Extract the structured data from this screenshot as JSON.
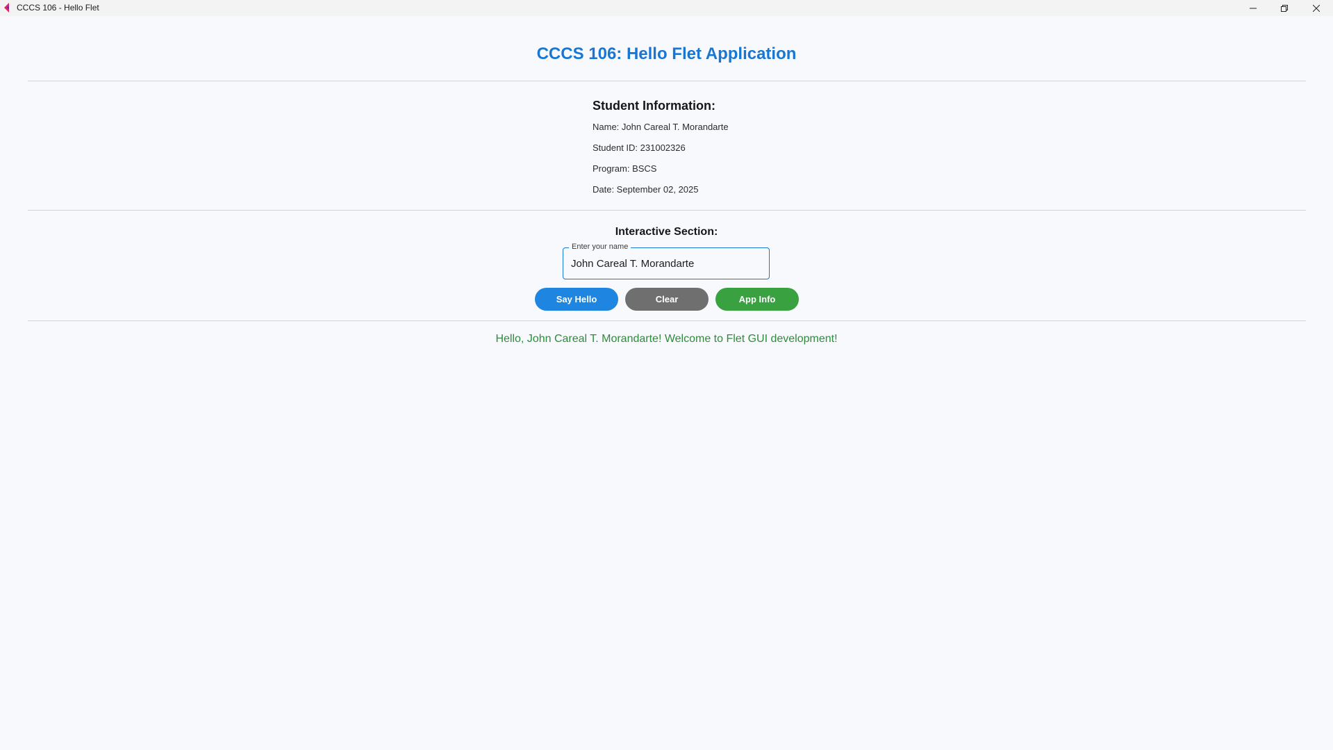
{
  "window": {
    "title": "CCCS 106 - Hello Flet",
    "icon": "flet-app-icon",
    "controls": [
      "minimize-icon",
      "restore-icon",
      "close-icon"
    ]
  },
  "header": {
    "title": "CCCS 106: Hello Flet Application"
  },
  "student_info": {
    "heading": "Student Information:",
    "name": "Name: John Careal T. Morandarte",
    "student_id": "Student ID: 231002326",
    "program": "Program: BSCS",
    "date": "Date: September 02, 2025"
  },
  "interactive": {
    "heading": "Interactive Section:",
    "name_field": {
      "label": "Enter your name",
      "value": "John Careal T. Morandarte"
    },
    "buttons": {
      "say_hello": "Say Hello",
      "clear": "Clear",
      "app_info": "App Info"
    }
  },
  "output": {
    "greeting": "Hello, John Careal T. Morandarte! Welcome to Flet GUI development!"
  },
  "colors": {
    "accent": "#1976d2",
    "say_hello_button": "#1e86e0",
    "clear_button": "#6f6f6f",
    "app_info_button": "#3aa140",
    "greeting_text": "#2e8b3a",
    "background": "#f7f9fd"
  }
}
